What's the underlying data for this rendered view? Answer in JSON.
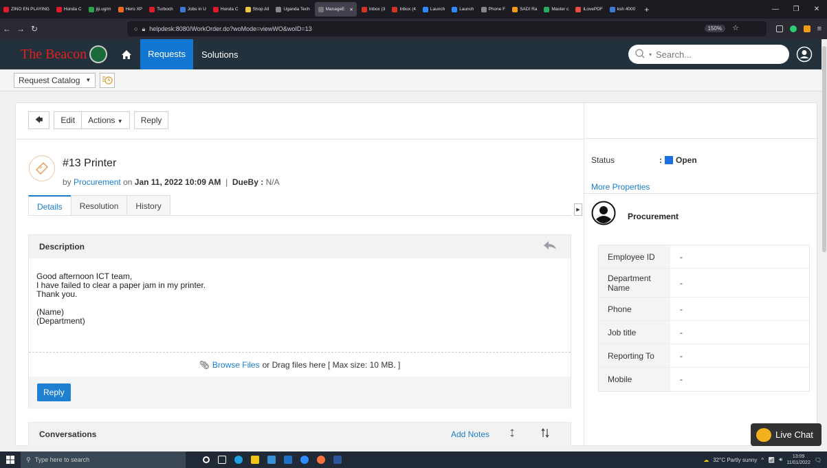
{
  "browser": {
    "tabs": [
      {
        "label": "ZINO EN PLAYING",
        "color": "#e21b2b",
        "active": false
      },
      {
        "label": "Honda C",
        "color": "#e21b2b",
        "active": false
      },
      {
        "label": "jiji.ug/m",
        "color": "#2ba24c",
        "active": false
      },
      {
        "label": "Hero XP",
        "color": "#f36a1a",
        "active": false
      },
      {
        "label": "Turboch",
        "color": "#e21b2b",
        "active": false
      },
      {
        "label": "Jobs in U",
        "color": "#3a7bd5",
        "active": false
      },
      {
        "label": "Honda C",
        "color": "#e21b2b",
        "active": false
      },
      {
        "label": "Shop All",
        "color": "#f4c542",
        "active": false
      },
      {
        "label": "Uganda Tech",
        "color": "#888888",
        "active": false
      },
      {
        "label": "ManageE",
        "color": "#777777",
        "active": true
      },
      {
        "label": "Inbox (3",
        "color": "#d93025",
        "active": false
      },
      {
        "label": "Inbox (4",
        "color": "#d93025",
        "active": false
      },
      {
        "label": "Launch",
        "color": "#2d8cff",
        "active": false
      },
      {
        "label": "Launch",
        "color": "#2d8cff",
        "active": false
      },
      {
        "label": "Phone F",
        "color": "#888888",
        "active": false
      },
      {
        "label": "SADI Ra",
        "color": "#f39c12",
        "active": false
      },
      {
        "label": "Master c",
        "color": "#27ae60",
        "active": false
      },
      {
        "label": "iLovePDF",
        "color": "#e74c3c",
        "active": false
      },
      {
        "label": "ksh 4000",
        "color": "#3a7bd5",
        "active": false
      }
    ],
    "url": "helpdesk:8080/WorkOrder.do?woMode=viewWO&woID=13",
    "zoom": "150%"
  },
  "header": {
    "brand": "The Beacon",
    "nav": {
      "requests": "Requests",
      "solutions": "Solutions"
    },
    "search_placeholder": "Search..."
  },
  "toolbar": {
    "catalog": "Request Catalog"
  },
  "actions": {
    "edit": "Edit",
    "actions": "Actions",
    "reply": "Reply"
  },
  "ticket": {
    "title": "#13  Printer",
    "by": "by",
    "requester": "Procurement",
    "on": "on",
    "date": "Jan 11, 2022 10:09 AM",
    "sep": "|",
    "dueby_label": "DueBy :",
    "dueby": "N/A"
  },
  "tabs": {
    "details": "Details",
    "resolution": "Resolution",
    "history": "History"
  },
  "description": {
    "heading": "Description",
    "lines": [
      "Good afternoon ICT team,",
      "I have failed to clear a paper jam in my printer.",
      "Thank you.",
      "",
      "(Name)",
      "(Department)"
    ],
    "browse": "Browse Files",
    "drag_text": "or Drag files here [ Max size: 10 MB. ]",
    "reply": "Reply"
  },
  "conversations": {
    "heading": "Conversations",
    "add_notes": "Add Notes"
  },
  "side": {
    "status_label": "Status",
    "status_colon": ":",
    "status_value": "Open",
    "status_color": "#1a6fe3",
    "more": "More Properties",
    "requester_name": "Procurement",
    "props": [
      {
        "label": "Employee ID",
        "value": "-"
      },
      {
        "label": "Department Name",
        "value": "-"
      },
      {
        "label": "Phone",
        "value": "-"
      },
      {
        "label": "Job title",
        "value": "-"
      },
      {
        "label": "Reporting To",
        "value": "-"
      },
      {
        "label": "Mobile",
        "value": "-"
      }
    ]
  },
  "live_chat": "Live Chat",
  "taskbar": {
    "search": "Type here to search",
    "weather": "32°C  Partly sunny",
    "time": "13:09",
    "date": "11/01/2022"
  }
}
